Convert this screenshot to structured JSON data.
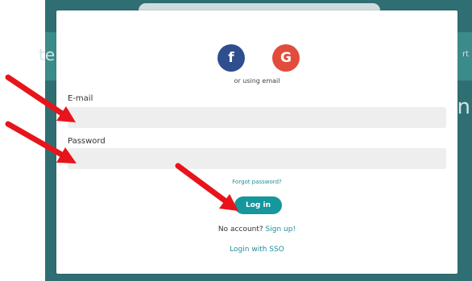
{
  "background": {
    "left_fragment": "te",
    "right_fragment_small": "rt",
    "right_fragment_large": "n"
  },
  "login_modal": {
    "social": [
      {
        "name": "facebook",
        "icon": "facebook-icon",
        "glyph": "f",
        "color": "#2f4e8e"
      },
      {
        "name": "google",
        "icon": "google-icon",
        "glyph": "G",
        "color": "#e24c3d"
      }
    ],
    "or_text": "or using email",
    "email_label": "E-mail",
    "email_value": "",
    "password_label": "Password",
    "password_value": "",
    "forgot_password": "Forgot password?",
    "login_button": "Log in",
    "no_account_text": "No account?",
    "signup_link": "Sign up!",
    "sso_link": "Login with SSO"
  },
  "annotations": {
    "arrow_color": "#e8141b",
    "arrow_targets": [
      "email-field",
      "password-field",
      "login-button"
    ]
  }
}
